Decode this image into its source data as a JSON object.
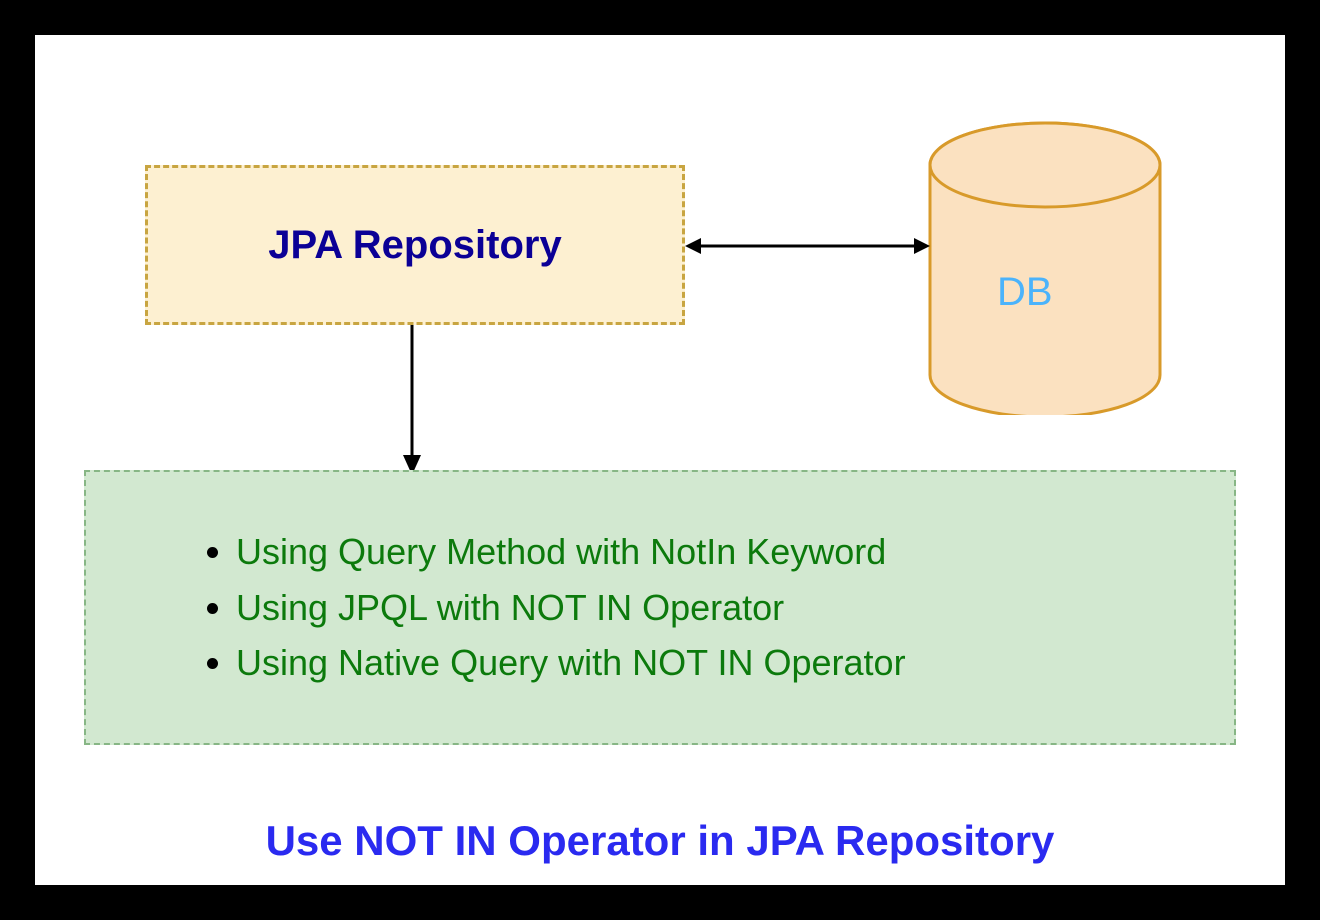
{
  "repo": {
    "label": "JPA Repository"
  },
  "db": {
    "label": "DB"
  },
  "methods": {
    "items": [
      "Using Query Method with NotIn Keyword",
      "Using JPQL with NOT IN Operator",
      "Using Native Query with NOT IN Operator"
    ]
  },
  "title": "Use NOT IN Operator in JPA Repository"
}
